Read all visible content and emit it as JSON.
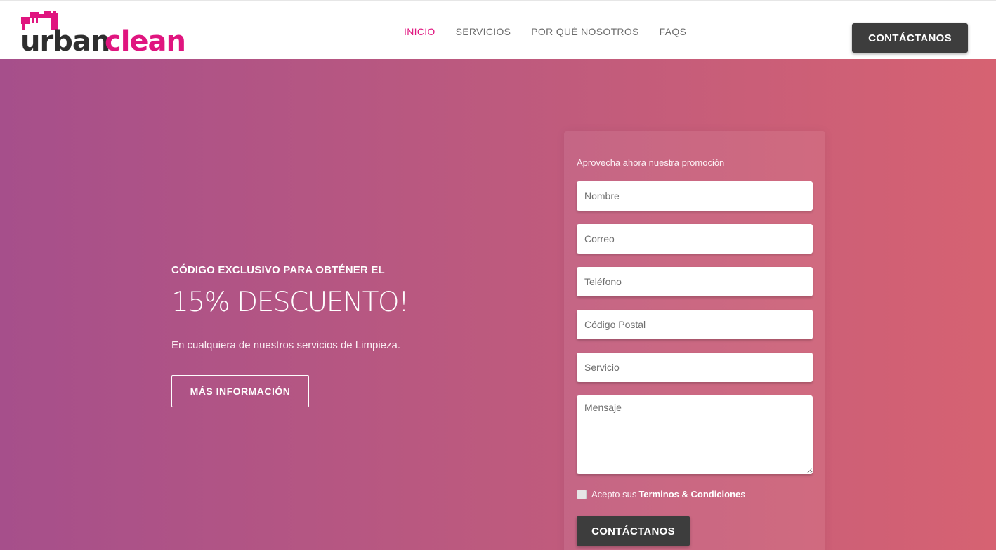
{
  "brand": {
    "logo_part1": "urban",
    "logo_part2": "clean",
    "dark_color": "#2e2e2e",
    "accent_color": "#e0157f"
  },
  "nav": {
    "items": [
      {
        "label": "INICIO",
        "active": true
      },
      {
        "label": "SERVICIOS",
        "active": false
      },
      {
        "label": "POR QUÉ NOSOTROS",
        "active": false
      },
      {
        "label": "FAQS",
        "active": false
      }
    ],
    "cta_label": "CONTÁCTANOS"
  },
  "hero": {
    "gradient_start": "#a64f8b",
    "gradient_end": "#d66272",
    "eyebrow": "CÓDIGO EXCLUSIVO PARA OBTÉNER EL",
    "headline": "15% DESCUENTO!",
    "description": "En cualquiera de nuestros servicios de Limpieza.",
    "more_label": "MÁS INFORMACIÓN"
  },
  "form": {
    "title": "Aprovecha ahora nuestra promoción",
    "fields": {
      "nombre": "Nombre",
      "correo": "Correo",
      "telefono": "Teléfono",
      "codigo_postal": "Código Postal",
      "servicio": "Servicio",
      "mensaje": "Mensaje"
    },
    "terms_prefix": "Acepto sus",
    "terms_link": "Terminos & Condiciones",
    "terms_checked": false,
    "submit_label": "CONTÁCTANOS"
  }
}
